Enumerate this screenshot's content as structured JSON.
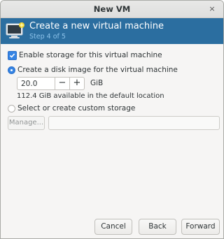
{
  "window": {
    "title": "New VM",
    "close_glyph": "×"
  },
  "header": {
    "title": "Create a new virtual machine",
    "subtitle": "Step 4 of 5",
    "icon": "vm-wizard-icon"
  },
  "storage": {
    "enable_label": "Enable storage for this virtual machine",
    "enable_checked": true,
    "create_disk_label": "Create a disk image for the virtual machine",
    "create_disk_selected": true,
    "disk_size_value": "20.0",
    "decrement_glyph": "−",
    "increment_glyph": "+",
    "unit": "GiB",
    "available_text": "112.4 GiB available in the default location",
    "custom_label": "Select or create custom storage",
    "custom_selected": false,
    "manage_label": "Manage...",
    "custom_path_value": ""
  },
  "buttons": {
    "cancel": "Cancel",
    "back": "Back",
    "forward": "Forward"
  },
  "colors": {
    "header_bg": "#2b6ea0",
    "subtitle": "#8dc3ea",
    "accent": "#3584e4"
  }
}
